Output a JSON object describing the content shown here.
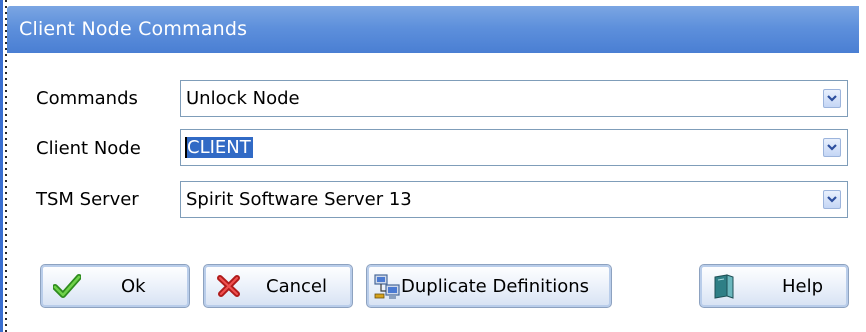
{
  "window": {
    "title": "Client Node Commands"
  },
  "form": {
    "commands": {
      "label": "Commands",
      "value": "Unlock Node"
    },
    "client_node": {
      "label": "Client Node",
      "value": "CLIENT"
    },
    "tsm_server": {
      "label": "TSM Server",
      "value": "Spirit Software Server 13"
    }
  },
  "buttons": {
    "ok": "Ok",
    "cancel": "Cancel",
    "duplicate": "Duplicate Definitions",
    "help": "Help"
  },
  "icons": {
    "ok": "check-icon",
    "cancel": "cross-icon",
    "duplicate": "network-computers-icon",
    "help": "book-icon",
    "dropdown": "chevron-down-icon"
  },
  "colors": {
    "title_bar": "#5e90dc",
    "selection": "#316ac5",
    "combo_border": "#7f9db9"
  }
}
